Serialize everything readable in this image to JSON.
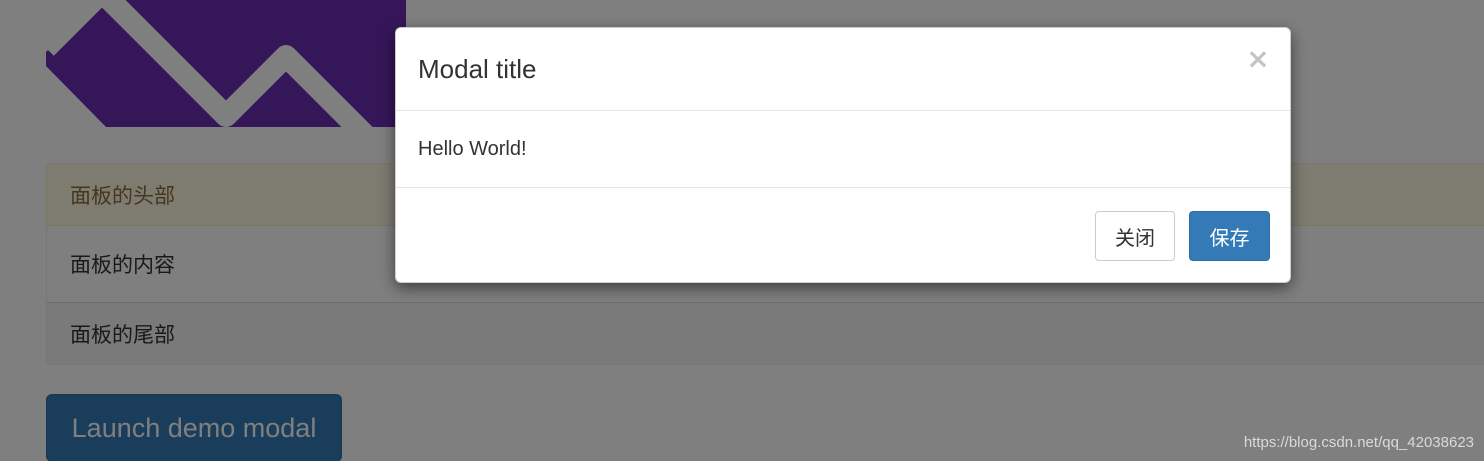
{
  "panel": {
    "heading": "面板的头部",
    "body": "面板的内容",
    "footer": "面板的尾部"
  },
  "launch_button": {
    "label": "Launch demo modal"
  },
  "modal": {
    "title": "Modal title",
    "close_icon": "×",
    "body_text": "Hello World!",
    "close_button_label": "关闭",
    "save_button_label": "保存"
  },
  "watermark": "https://blog.csdn.net/qq_42038623",
  "colors": {
    "image_purple": "#6b2fb3",
    "primary": "#337ab7",
    "panel_warning_bg": "#fcf8e3",
    "panel_warning_text": "#8a6d3b"
  }
}
